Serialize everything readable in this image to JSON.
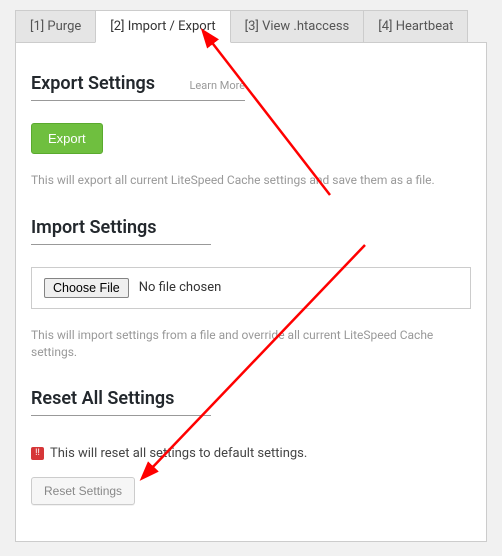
{
  "tabs": {
    "purge": "[1] Purge",
    "import_export": "[2] Import / Export",
    "view_htaccess": "[3] View .htaccess",
    "heartbeat": "[4] Heartbeat"
  },
  "export": {
    "title": "Export Settings",
    "learn_more": "Learn More",
    "button": "Export",
    "desc": "This will export all current LiteSpeed Cache settings and save them as a file."
  },
  "import": {
    "title": "Import Settings",
    "choose_file": "Choose File",
    "no_file": "No file chosen",
    "desc": "This will import settings from a file and override all current LiteSpeed Cache settings."
  },
  "reset": {
    "title": "Reset All Settings",
    "note": "This will reset all settings to default settings.",
    "button": "Reset Settings"
  }
}
